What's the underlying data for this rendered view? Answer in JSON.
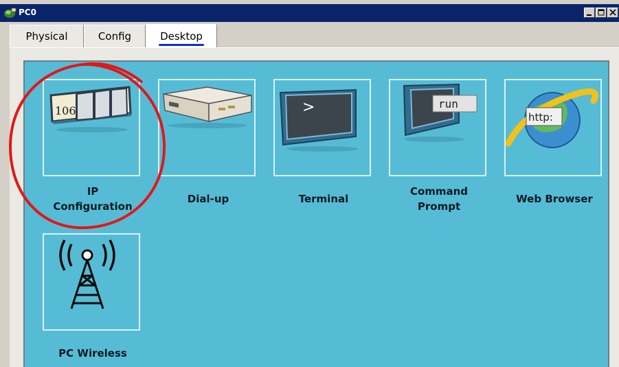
{
  "window": {
    "title": "PC0"
  },
  "tabs": [
    {
      "label": "Physical"
    },
    {
      "label": "Config"
    },
    {
      "label": "Desktop",
      "active": true
    }
  ],
  "apps": [
    {
      "label_line1": "IP",
      "label_line2": "Configuration",
      "icon": "ip-configuration-icon",
      "badge": "106"
    },
    {
      "label_line1": "",
      "label_line2": "Dial-up",
      "icon": "dialup-modem-icon"
    },
    {
      "label_line1": "",
      "label_line2": "Terminal",
      "icon": "terminal-icon",
      "glyph": ">"
    },
    {
      "label_line1": "Command",
      "label_line2": "Prompt",
      "icon": "command-prompt-icon",
      "badge": "run"
    },
    {
      "label_line1": "",
      "label_line2": "Web Browser",
      "icon": "web-browser-icon",
      "badge": "http:"
    },
    {
      "label_line1": "",
      "label_line2": "PC Wireless",
      "icon": "wireless-tower-icon"
    }
  ],
  "colors": {
    "titlebar": "#0a246a",
    "desktop": "#56bcd6",
    "highlight_circle": "#e01818",
    "tab_underline": "#0a2fd8"
  }
}
